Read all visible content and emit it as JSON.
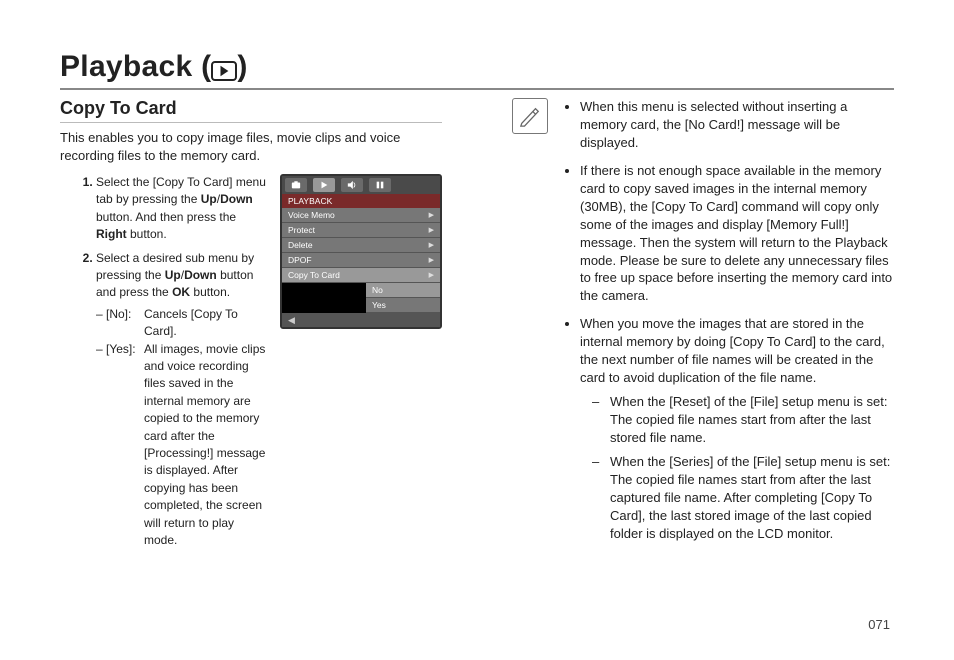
{
  "page_number": "071",
  "title": {
    "text": "Playback (",
    "close": ")",
    "icon_name": "playback-icon"
  },
  "section": {
    "heading": "Copy To Card",
    "intro": "This enables you to copy image files, movie clips and voice recording files to the memory card.",
    "steps": [
      {
        "pre": "Select the [Copy To Card] menu tab by pressing the ",
        "b1": "Up",
        "mid1": "/",
        "b2": "Down",
        "mid2": " button. And then press the ",
        "b3": "Right",
        "post": " button."
      },
      {
        "pre": "Select a desired sub menu by pressing the ",
        "b1": "Up",
        "mid1": "/",
        "b2": "Down",
        "mid2": " button and press the ",
        "b3": "OK",
        "post": " button."
      }
    ],
    "options": [
      {
        "key": "– [No]:",
        "txt": "Cancels [Copy To Card]."
      },
      {
        "key": "– [Yes]:",
        "txt": "All images, movie clips and voice recording files saved in the internal memory are copied to the memory card after the [Processing!] message is displayed. After copying has been completed, the screen will return to play mode."
      }
    ]
  },
  "device_menu": {
    "header": "PLAYBACK",
    "items": [
      {
        "label": "Voice Memo",
        "selected": false
      },
      {
        "label": "Protect",
        "selected": false
      },
      {
        "label": "Delete",
        "selected": false
      },
      {
        "label": "DPOF",
        "selected": false
      },
      {
        "label": "Copy To Card",
        "selected": true
      }
    ],
    "sub": [
      {
        "label": "No",
        "selected": true
      },
      {
        "label": "Yes",
        "selected": false
      }
    ]
  },
  "notes": [
    "When this menu is selected without inserting a memory card, the [No Card!] message will be displayed.",
    "If there is not enough space available in the memory card to copy saved images in the internal memory (30MB), the [Copy To Card] command will copy only some of the images and display [Memory Full!] message. Then the system will return to the Playback mode. Please be sure to delete any unnecessary files to free up space before inserting the memory card into the camera.",
    "When you move the images that are stored in the internal memory by doing [Copy To Card] to the card, the next number of file names will be created in the card to avoid duplication of the file name."
  ],
  "sub_notes": [
    "When the [Reset] of the [File] setup menu is set: The copied file names start from after the last stored file name.",
    "When the [Series] of the [File] setup menu is set: The copied file names start from after the last captured file name. After completing [Copy To Card], the last stored image of the last copied folder is displayed on the LCD monitor."
  ]
}
